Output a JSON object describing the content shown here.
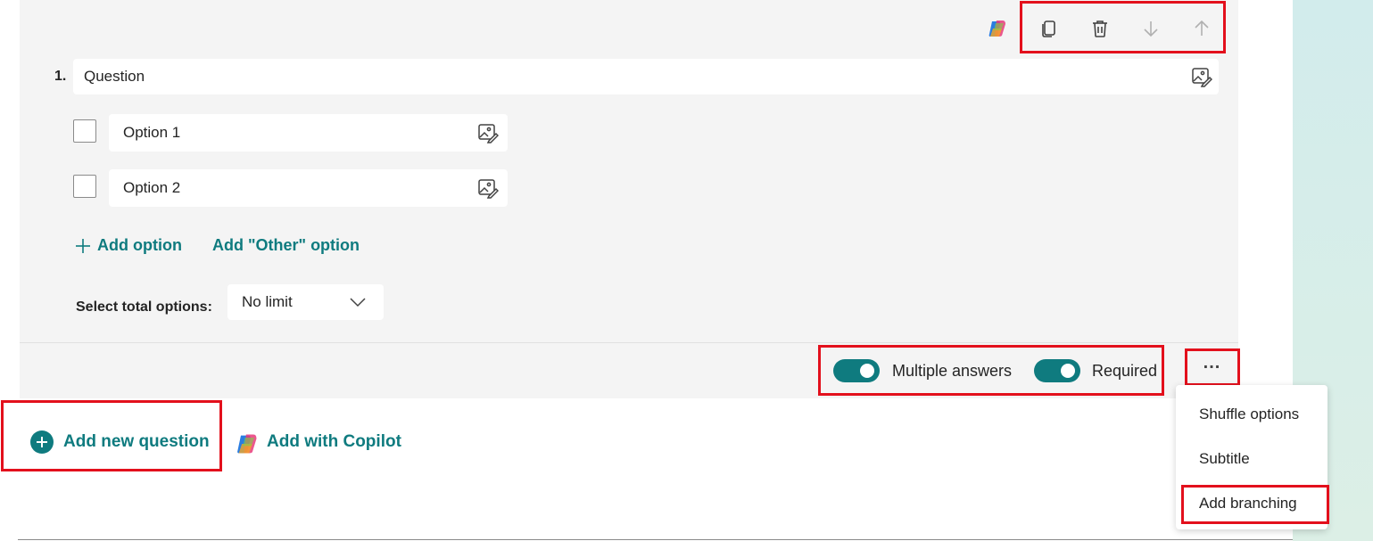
{
  "question": {
    "number": "1.",
    "placeholder": "Question",
    "options": [
      {
        "label": "Option 1"
      },
      {
        "label": "Option 2"
      }
    ],
    "add_option_label": "Add option",
    "add_other_label": "Add \"Other\" option",
    "select_total_label": "Select total options:",
    "select_total_value": "No limit"
  },
  "toolbar": {
    "icons": [
      "copilot-icon",
      "copy-icon",
      "delete-icon",
      "move-down-icon",
      "move-up-icon"
    ]
  },
  "footer": {
    "multiple_answers_label": "Multiple answers",
    "multiple_answers_on": true,
    "required_label": "Required",
    "required_on": true,
    "more_label": "..."
  },
  "add_bar": {
    "add_new_question_label": "Add new question",
    "add_with_copilot_label": "Add with Copilot"
  },
  "more_menu": {
    "items": [
      "Shuffle options",
      "Subtitle",
      "Add branching"
    ]
  },
  "colors": {
    "accent": "#0f7b7f",
    "highlight": "#e3101c",
    "card": "#f4f4f4"
  }
}
